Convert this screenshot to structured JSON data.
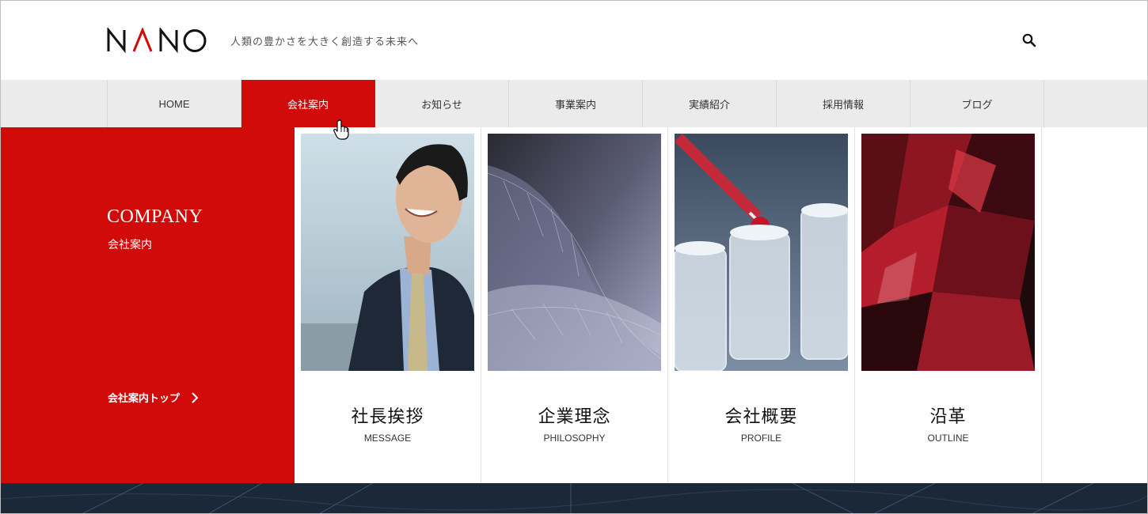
{
  "header": {
    "logo_text": "NANO",
    "tagline": "人類の豊かさを大きく創造する未来へ",
    "search_icon": "search-icon"
  },
  "nav": {
    "items": [
      {
        "label": "HOME"
      },
      {
        "label": "会社案内",
        "active": true
      },
      {
        "label": "お知らせ"
      },
      {
        "label": "事業案内"
      },
      {
        "label": "実績紹介"
      },
      {
        "label": "採用情報"
      },
      {
        "label": "ブログ"
      }
    ]
  },
  "mega": {
    "en_title": "COMPANY",
    "jp_title": "会社案内",
    "top_link": "会社案内トップ",
    "cards": [
      {
        "title": "社長挨拶",
        "subtitle": "MESSAGE",
        "image": "businessman-photo"
      },
      {
        "title": "企業理念",
        "subtitle": "PHILOSOPHY",
        "image": "leaf-skeleton-photo"
      },
      {
        "title": "会社概要",
        "subtitle": "PROFILE",
        "image": "laboratory-pipette-photo"
      },
      {
        "title": "沿革",
        "subtitle": "OUTLINE",
        "image": "red-crystal-photo"
      }
    ]
  },
  "colors": {
    "accent": "#d10a0a",
    "nav_bg": "#ebebeb"
  }
}
